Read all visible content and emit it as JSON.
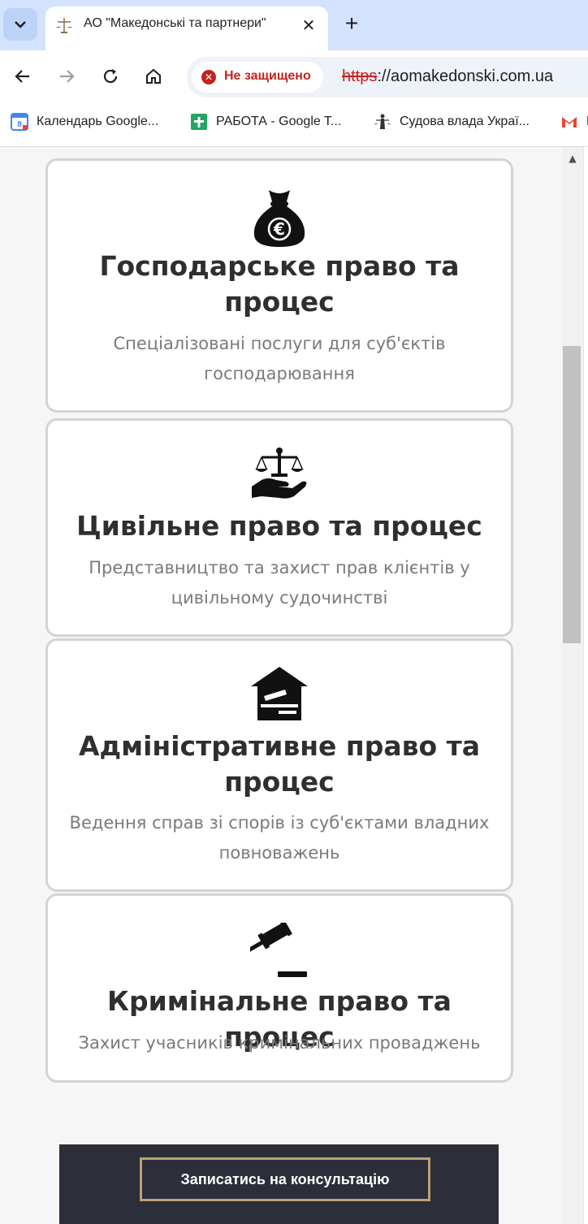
{
  "browser": {
    "tab": {
      "title": "АО \"Македонські та партнери\"",
      "close_glyph": "✕"
    },
    "new_tab_glyph": "+",
    "security_label": "Не защищено",
    "security_glyph": "✕",
    "url_scheme": "https",
    "url_rest": "://aomakedonski.com.ua",
    "bookmarks": [
      {
        "label": "Календарь Google...",
        "icon": "google-calendar-icon"
      },
      {
        "label": "РАБОТА - Google T...",
        "icon": "google-sheets-icon"
      },
      {
        "label": "Судова влада Украї...",
        "icon": "themis-icon"
      },
      {
        "label": "M",
        "icon": "gmail-icon"
      }
    ]
  },
  "cards": [
    {
      "icon": "money-bag-euro-icon",
      "title": "Господарське право та процес",
      "description": "Спеціалізовані послуги для суб'єктів господарювання"
    },
    {
      "icon": "scales-in-hand-icon",
      "title": "Цивільне право та процес",
      "description": "Представництво та захист прав клієнтів у цивільному судочинстві"
    },
    {
      "icon": "courthouse-gavel-icon",
      "title": "Адміністративне право та процес",
      "description": "Ведення справ зі спорів із суб'єктами владних повноважень"
    },
    {
      "icon": "gavel-icon",
      "title": "Кримінальне право та процес",
      "description": "Захист учасників кримінальних проваджень"
    }
  ],
  "cta": {
    "label": "Записатись на консультацію"
  },
  "colors": {
    "accent_gold": "#c1a075",
    "dark_band": "#2c2e3a",
    "insecure_red": "#c5221f"
  }
}
